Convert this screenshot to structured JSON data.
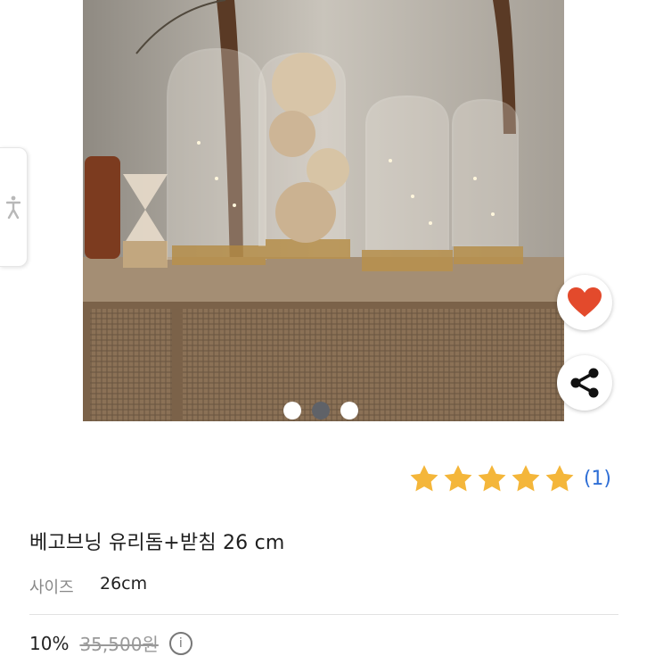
{
  "product": {
    "title": "베고브닝 유리돔+받침 26 cm",
    "option_label": "사이즈",
    "option_value": "26cm",
    "rating_count": "(1)",
    "rating_value": 5,
    "discount": "10%",
    "original_price": "35,500원"
  },
  "gallery": {
    "slide_count": 3,
    "active_index": 0
  },
  "colors": {
    "heart": "#e34a2c",
    "star": "#f4b63a",
    "link": "#2f6fd6"
  },
  "icons": [
    "accessibility-icon",
    "heart-icon",
    "share-icon",
    "info-icon",
    "star-icon"
  ]
}
